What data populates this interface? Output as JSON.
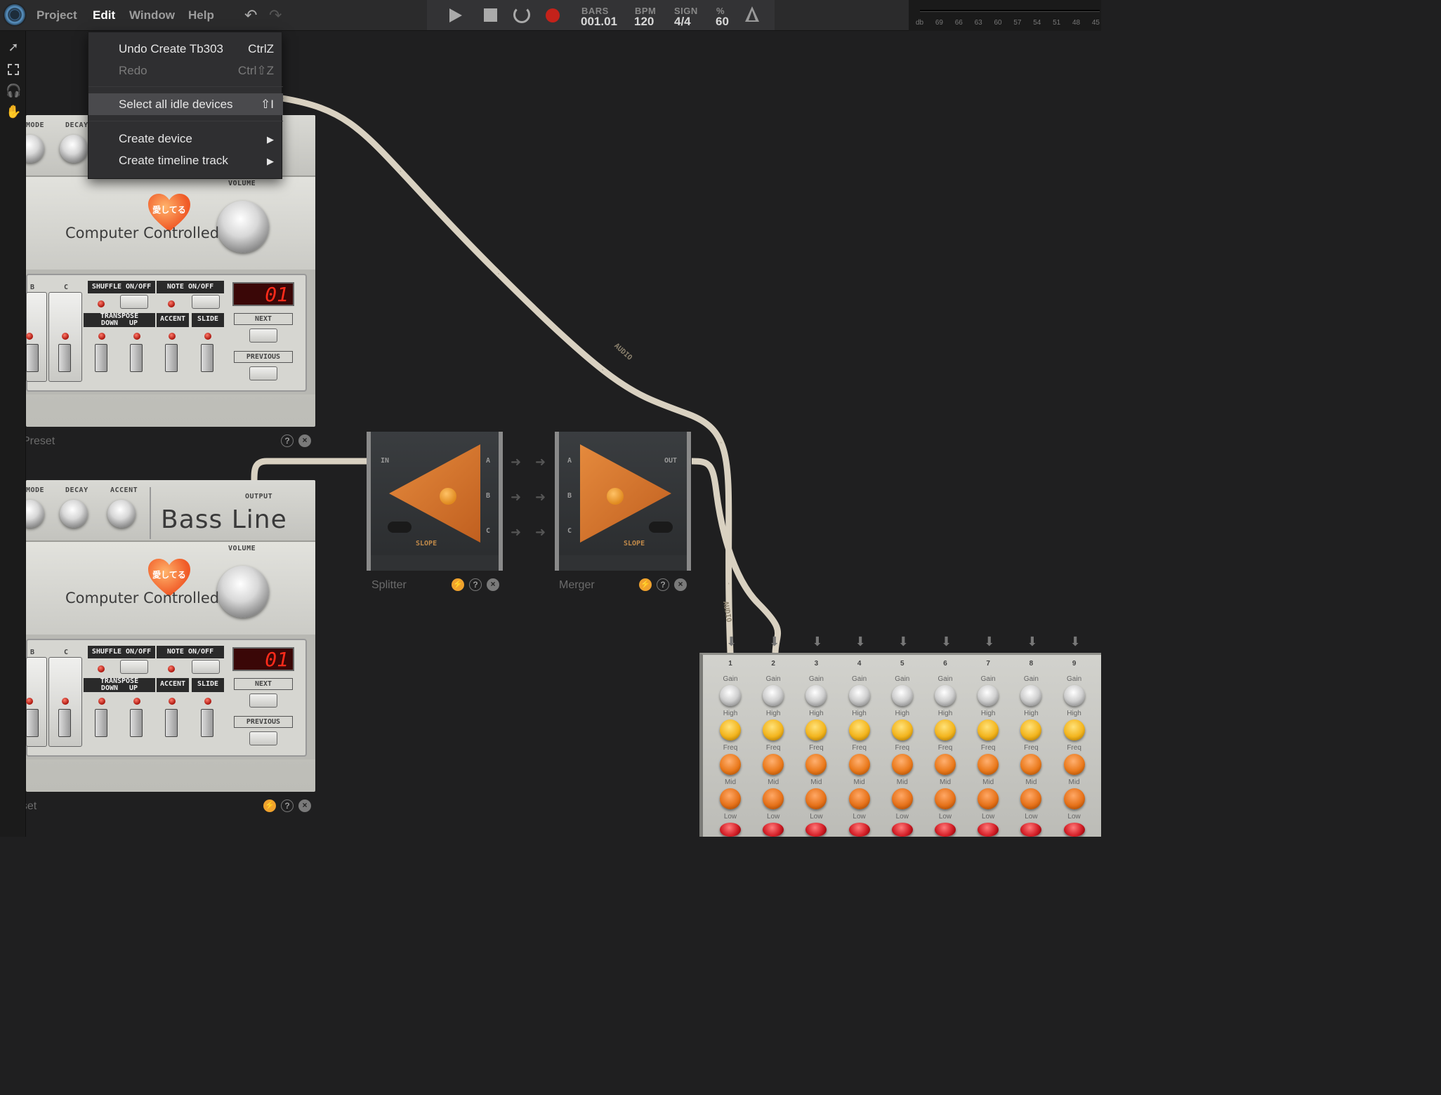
{
  "menubar": {
    "items": [
      "Project",
      "Edit",
      "Window",
      "Help"
    ],
    "active": "Edit"
  },
  "transport": {
    "bars_label": "BARS",
    "bars_value": "001.01",
    "bpm_label": "BPM",
    "bpm_value": "120",
    "sign_label": "SIGN",
    "sign_value": "4/4",
    "pct_label": "%",
    "pct_value": "60"
  },
  "meter": {
    "labels": [
      "db",
      "69",
      "66",
      "63",
      "60",
      "57",
      "54",
      "51",
      "48",
      "45"
    ]
  },
  "edit_menu": {
    "items": [
      {
        "label": "Undo Create Tb303",
        "shortcut": "CtrlZ",
        "disabled": false,
        "highlight": false
      },
      {
        "label": "Redo",
        "shortcut": "Ctrl⇧Z",
        "disabled": true,
        "highlight": false
      },
      {
        "label": "Select all idle devices",
        "shortcut": "⇧I",
        "disabled": false,
        "highlight": true
      },
      {
        "label": "Create device",
        "shortcut": "▶",
        "disabled": false,
        "highlight": false
      },
      {
        "label": "Create timeline track",
        "shortcut": "▶",
        "disabled": false,
        "highlight": false
      }
    ]
  },
  "tb303_top": {
    "mode": "MODE",
    "decay": "DECAY",
    "volume": "VOLUME",
    "cc": "Computer Controlled",
    "heart": "愛してる",
    "b": "B",
    "c": "C",
    "shuffle": "SHUFFLE ON/OFF",
    "note": "NOTE ON/OFF",
    "transpose": "TRANSPOSE",
    "down": "DOWN",
    "up": "UP",
    "accent_btn": "ACCENT",
    "slide": "SLIDE",
    "lcd": "01",
    "next": "NEXT",
    "previous": "PREVIOUS",
    "footer": "Preset"
  },
  "tb303_bottom": {
    "mode": "MODE",
    "decay": "DECAY",
    "accent": "ACCENT",
    "output": "OUTPUT",
    "name": "Bass Line",
    "volume": "VOLUME",
    "cc": "Computer Controlled",
    "heart": "愛してる",
    "b": "B",
    "c": "C",
    "shuffle": "SHUFFLE ON/OFF",
    "note": "NOTE ON/OFF",
    "transpose": "TRANSPOSE",
    "down": "DOWN",
    "up": "UP",
    "accent_btn": "ACCENT",
    "slide": "SLIDE",
    "lcd": "01",
    "next": "NEXT",
    "previous": "PREVIOUS",
    "footer": "Preset"
  },
  "splitter": {
    "name": "Splitter",
    "in": "IN",
    "a": "A",
    "b": "B",
    "c": "C",
    "slope": "SLOPE"
  },
  "merger": {
    "name": "Merger",
    "out": "OUT",
    "a": "A",
    "b": "B",
    "c": "C",
    "slope": "SLOPE"
  },
  "cables": {
    "audio": "AUDIO"
  },
  "mixer": {
    "channels": [
      "1",
      "2",
      "3",
      "4",
      "5",
      "6",
      "7",
      "8",
      "9"
    ],
    "labels": [
      "Gain",
      "High",
      "Freq",
      "Mid",
      "Low"
    ]
  }
}
